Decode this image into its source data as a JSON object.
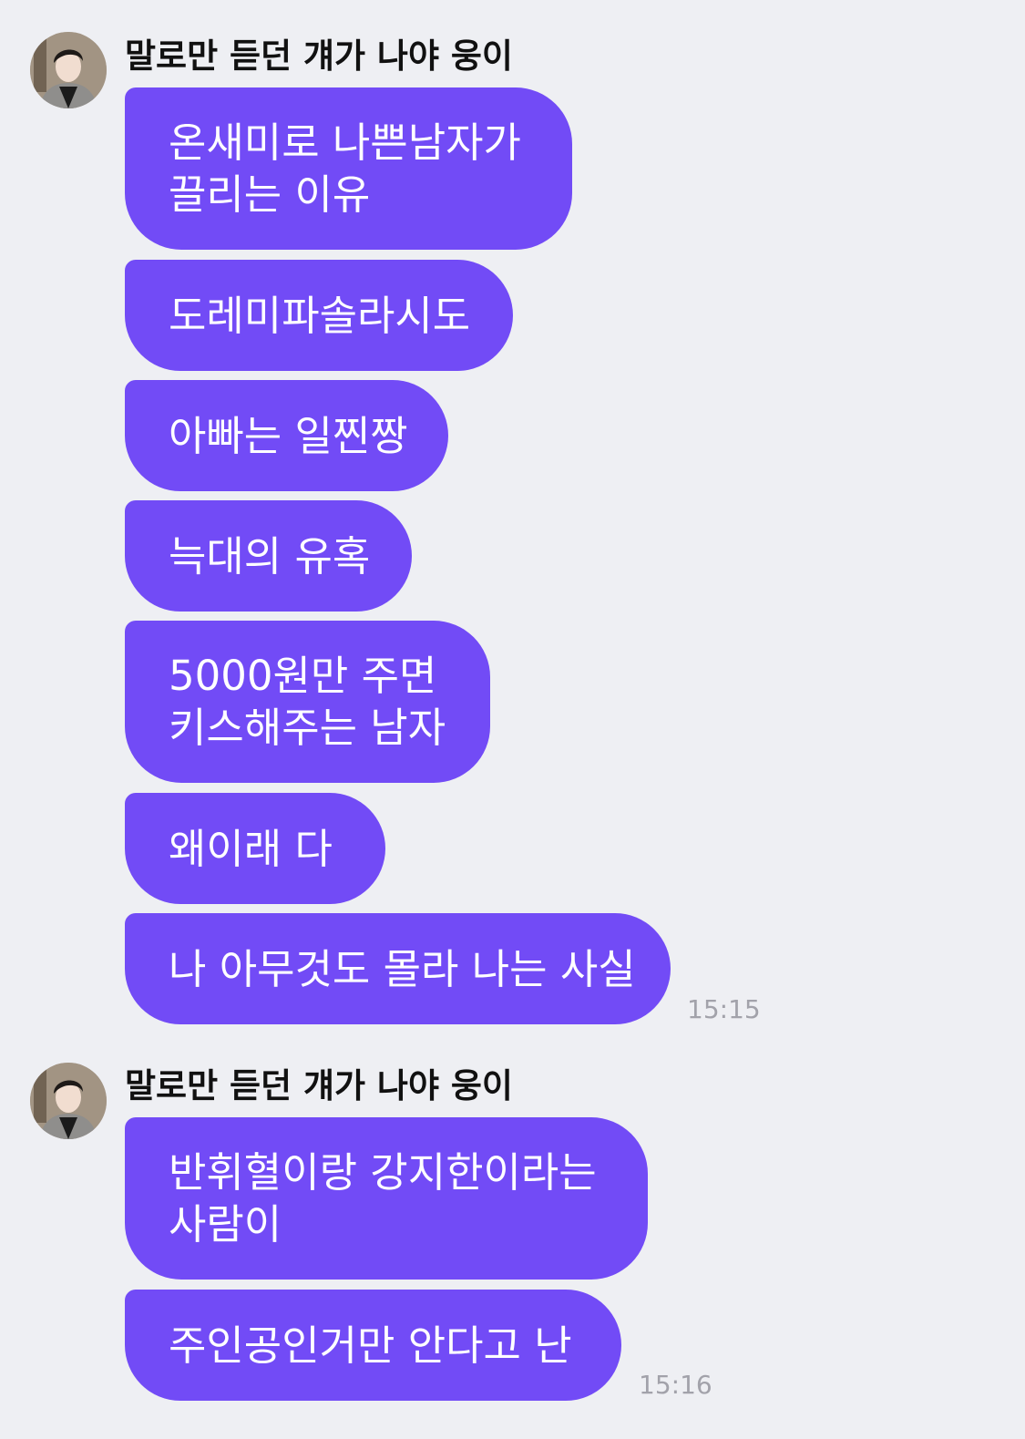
{
  "groups": [
    {
      "sender": "말로만 듣던 걔가 나야 웅이",
      "messages": [
        {
          "lines": [
            "온새미로 나쁜남자가",
            "끌리는 이유"
          ]
        },
        {
          "lines": [
            "도레미파솔라시도"
          ]
        },
        {
          "lines": [
            "아빠는 일찐짱"
          ]
        },
        {
          "lines": [
            "늑대의 유혹"
          ]
        },
        {
          "lines": [
            "5000원만 주면",
            "키스해주는 남자"
          ]
        },
        {
          "lines": [
            "왜이래 다"
          ]
        },
        {
          "lines": [
            "나 아무것도 몰라 나는 사실"
          ]
        }
      ],
      "time": "15:15"
    },
    {
      "sender": "말로만 듣던 걔가 나야 웅이",
      "messages": [
        {
          "lines": [
            "반휘혈이랑 강지한이라는",
            "사람이"
          ]
        },
        {
          "lines": [
            "주인공인거만 안다고 난"
          ]
        }
      ],
      "time": "15:16"
    }
  ],
  "colors": {
    "background": "#eeeff3",
    "bubble": "#724bf6",
    "bubble_text": "#ffffff",
    "sender_text": "#111111",
    "time_text": "#a2a2aa"
  },
  "icons": {
    "avatar": "profile-photo"
  }
}
